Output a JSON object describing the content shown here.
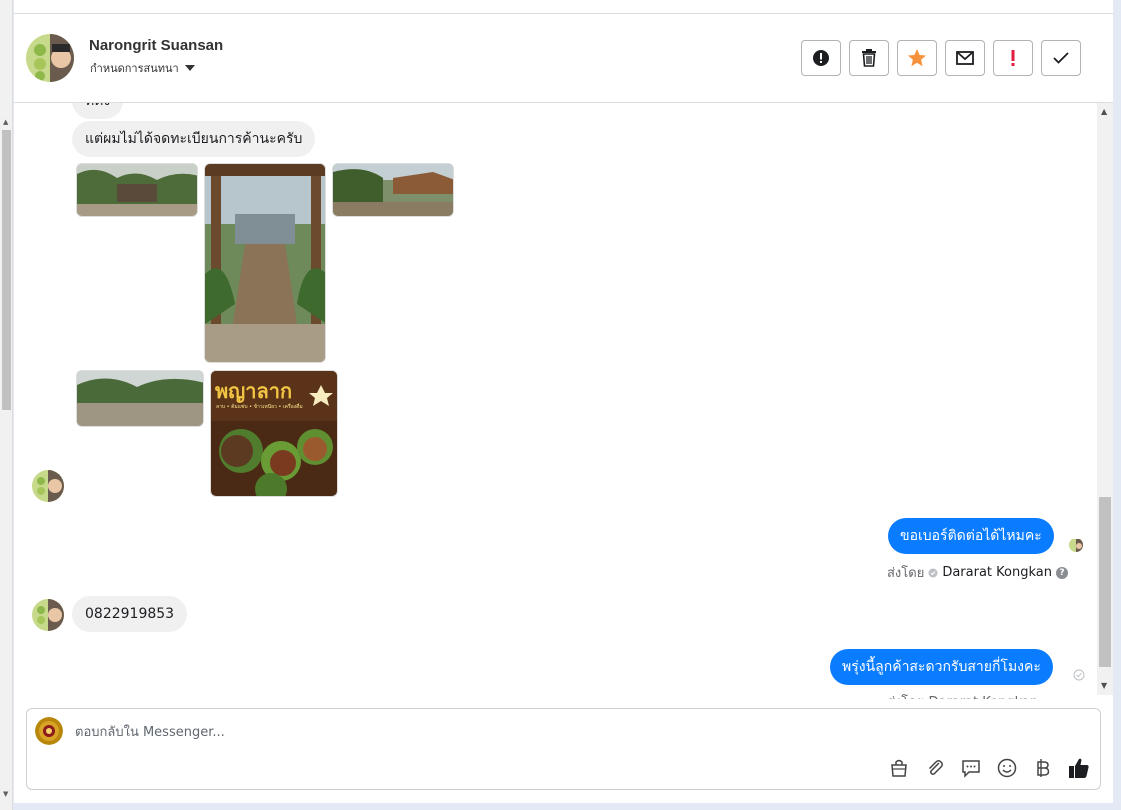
{
  "header": {
    "name": "Narongrit Suansan",
    "subtitle": "กำหนดการสนทนา",
    "actions": [
      {
        "id": "spam",
        "icon": "alert-circle-icon"
      },
      {
        "id": "delete",
        "icon": "trash-icon"
      },
      {
        "id": "star",
        "icon": "star-icon"
      },
      {
        "id": "mark-unread",
        "icon": "envelope-icon"
      },
      {
        "id": "important",
        "icon": "exclamation-icon"
      },
      {
        "id": "done",
        "icon": "check-icon"
      }
    ]
  },
  "messages": {
    "partial_top": "ที่ตั้ง",
    "msg1": "แต่ผมไม่ได้จดทะเบียนการค้านะครับ",
    "sign_title": "พญาลาก",
    "sign_sub": "ลาบ • ต้มแซ่บ • ข้าวเหนียว • เครื่องดื่ม",
    "out1": "ขอเบอร์ติดต่อได้ไหมคะ",
    "sentby_label": "ส่งโดย",
    "sentby_name": "Dararat Kongkan",
    "phone": "0822919853",
    "out2": "พรุ่งนี้ลูกค้าสะดวกรับสายกี่โมงคะ",
    "partial_bottom": "ส่งโดย Dararat Kongkan"
  },
  "composer": {
    "placeholder": "ตอบกลับใน Messenger..."
  },
  "colors": {
    "brand_blue": "#0a7cff",
    "star_orange": "#f7923a",
    "important_red": "#e41e3f"
  }
}
